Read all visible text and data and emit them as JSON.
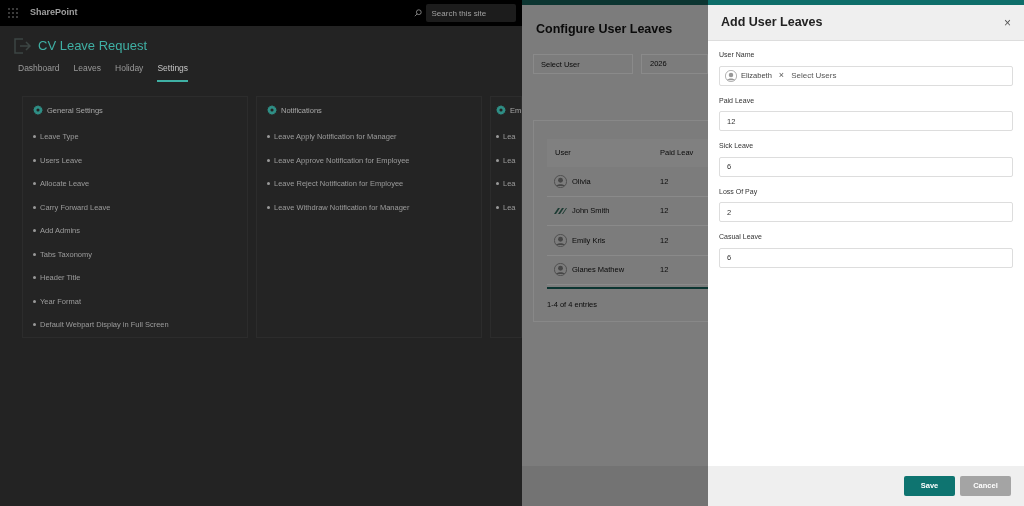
{
  "top_bar": {
    "app_name": "SharePoint",
    "search": {
      "placeholder": "Search this site"
    }
  },
  "page": {
    "title": "CV Leave Request",
    "tabs": [
      {
        "label": "Dashboard",
        "selected": false
      },
      {
        "label": "Leaves",
        "selected": false
      },
      {
        "label": "Holiday",
        "selected": false
      },
      {
        "label": "Settings",
        "selected": true
      }
    ],
    "cards": [
      {
        "title": "General Settings",
        "items": [
          "Leave Type",
          "Users Leave",
          "Allocate Leave",
          "Carry Forward Leave",
          "Add Admins",
          "Tabs Taxonomy",
          "Header Title",
          "Year Format",
          "Default Webpart Display in Full Screen"
        ]
      },
      {
        "title": "Notifications",
        "items": [
          "Leave Apply Notification for Manager",
          "Leave Approve Notification for Employee",
          "Leave Reject Notification for Employee",
          "Leave Withdraw Notification for Manager"
        ]
      },
      {
        "title": "Em",
        "items": [
          "Lea",
          "Lea",
          "Lea",
          "Lea"
        ]
      }
    ]
  },
  "configure_panel": {
    "title": "Configure User Leaves",
    "user_filter": {
      "placeholder": "Select User"
    },
    "year": "2026",
    "table": {
      "columns": [
        "User",
        "Paid Leav"
      ],
      "rows": [
        {
          "user": "Olivia",
          "kind": "avatar",
          "paid_leave": "12"
        },
        {
          "user": "John Smith",
          "kind": "logo",
          "paid_leave": "12"
        },
        {
          "user": "Emily Kris",
          "kind": "avatar",
          "paid_leave": "12"
        },
        {
          "user": "Glanes Mathew",
          "kind": "avatar",
          "paid_leave": "12"
        }
      ]
    },
    "footer": "1-4 of 4 entries"
  },
  "add_panel": {
    "title": "Add User Leaves",
    "close": "×",
    "user_name": {
      "label": "User Name",
      "selected_user": "Elizabeth",
      "remove": "×",
      "placeholder": "Select Users"
    },
    "fields": [
      {
        "label": "Paid Leave",
        "value": "12"
      },
      {
        "label": "Sick Leave",
        "value": "6"
      },
      {
        "label": "Loss Of Pay",
        "value": "2"
      },
      {
        "label": "Casual Leave",
        "value": "6"
      }
    ],
    "buttons": [
      {
        "label": "Save",
        "kind": "primary"
      },
      {
        "label": "Cancel",
        "kind": "secondary"
      }
    ]
  }
}
